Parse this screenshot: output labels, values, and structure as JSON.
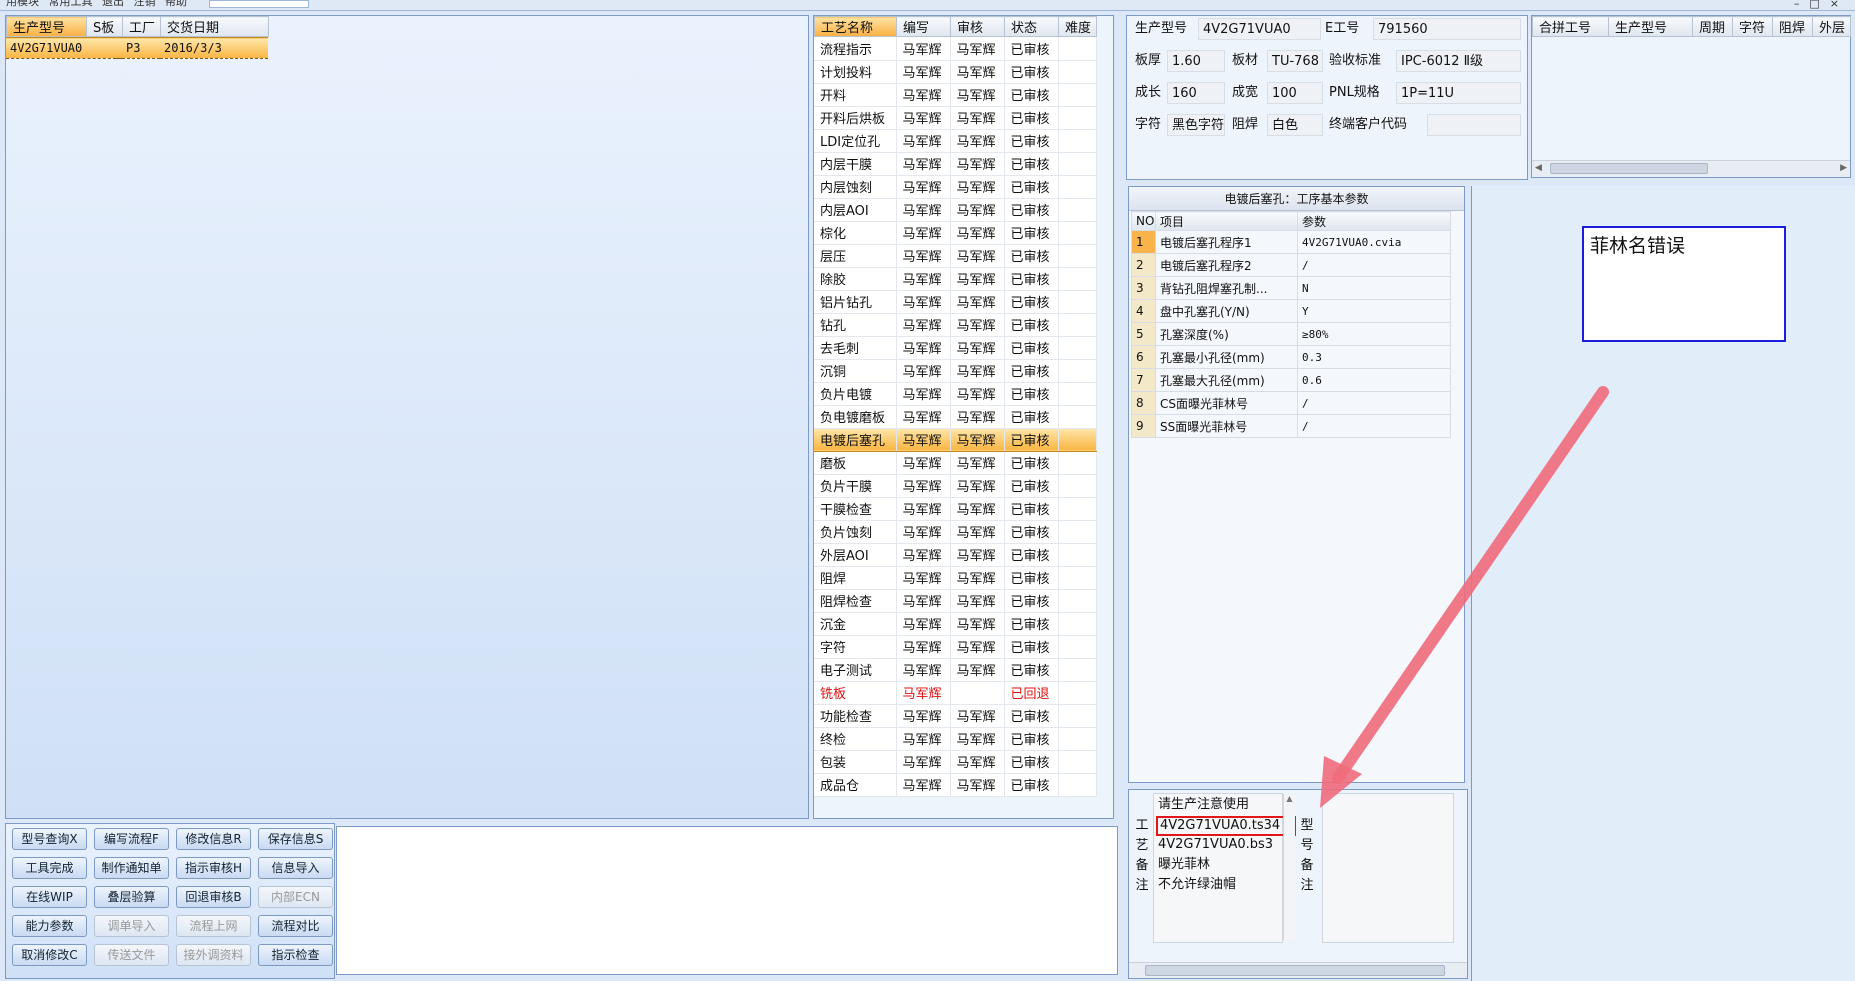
{
  "menubar": {
    "items": [
      "用模块",
      "常用工具",
      "退出",
      "注销",
      "帮助"
    ]
  },
  "window_controls": [
    "–",
    "□",
    "×"
  ],
  "orders": {
    "headers": [
      "生产型号",
      "S板",
      "工厂",
      "交货日期"
    ],
    "rows": [
      {
        "model": "4V2G71VUA0",
        "s": "",
        "factory": "P3",
        "date": "2016/3/3"
      }
    ]
  },
  "process": {
    "headers": [
      "工艺名称",
      "编写",
      "审核",
      "状态",
      "难度"
    ],
    "rows": [
      {
        "name": "流程指示",
        "writer": "马军辉",
        "reviewer": "马军辉",
        "status": "已审核"
      },
      {
        "name": "计划投料",
        "writer": "马军辉",
        "reviewer": "马军辉",
        "status": "已审核"
      },
      {
        "name": "开料",
        "writer": "马军辉",
        "reviewer": "马军辉",
        "status": "已审核"
      },
      {
        "name": "开料后烘板",
        "writer": "马军辉",
        "reviewer": "马军辉",
        "status": "已审核"
      },
      {
        "name": "LDI定位孔",
        "writer": "马军辉",
        "reviewer": "马军辉",
        "status": "已审核"
      },
      {
        "name": "内层干膜",
        "writer": "马军辉",
        "reviewer": "马军辉",
        "status": "已审核"
      },
      {
        "name": "内层蚀刻",
        "writer": "马军辉",
        "reviewer": "马军辉",
        "status": "已审核"
      },
      {
        "name": "内层AOI",
        "writer": "马军辉",
        "reviewer": "马军辉",
        "status": "已审核"
      },
      {
        "name": "棕化",
        "writer": "马军辉",
        "reviewer": "马军辉",
        "status": "已审核"
      },
      {
        "name": "层压",
        "writer": "马军辉",
        "reviewer": "马军辉",
        "status": "已审核"
      },
      {
        "name": "除胶",
        "writer": "马军辉",
        "reviewer": "马军辉",
        "status": "已审核"
      },
      {
        "name": "铝片钻孔",
        "writer": "马军辉",
        "reviewer": "马军辉",
        "status": "已审核"
      },
      {
        "name": "钻孔",
        "writer": "马军辉",
        "reviewer": "马军辉",
        "status": "已审核"
      },
      {
        "name": "去毛刺",
        "writer": "马军辉",
        "reviewer": "马军辉",
        "status": "已审核"
      },
      {
        "name": "沉铜",
        "writer": "马军辉",
        "reviewer": "马军辉",
        "status": "已审核"
      },
      {
        "name": "负片电镀",
        "writer": "马军辉",
        "reviewer": "马军辉",
        "status": "已审核"
      },
      {
        "name": "负电镀磨板",
        "writer": "马军辉",
        "reviewer": "马军辉",
        "status": "已审核"
      },
      {
        "name": "电镀后塞孔",
        "writer": "马军辉",
        "reviewer": "马军辉",
        "status": "已审核"
      },
      {
        "name": "磨板",
        "writer": "马军辉",
        "reviewer": "马军辉",
        "status": "已审核"
      },
      {
        "name": "负片干膜",
        "writer": "马军辉",
        "reviewer": "马军辉",
        "status": "已审核"
      },
      {
        "name": "干膜检查",
        "writer": "马军辉",
        "reviewer": "马军辉",
        "status": "已审核"
      },
      {
        "name": "负片蚀刻",
        "writer": "马军辉",
        "reviewer": "马军辉",
        "status": "已审核"
      },
      {
        "name": "外层AOI",
        "writer": "马军辉",
        "reviewer": "马军辉",
        "status": "已审核"
      },
      {
        "name": "阻焊",
        "writer": "马军辉",
        "reviewer": "马军辉",
        "status": "已审核"
      },
      {
        "name": "阻焊检查",
        "writer": "马军辉",
        "reviewer": "马军辉",
        "status": "已审核"
      },
      {
        "name": "沉金",
        "writer": "马军辉",
        "reviewer": "马军辉",
        "status": "已审核"
      },
      {
        "name": "字符",
        "writer": "马军辉",
        "reviewer": "马军辉",
        "status": "已审核"
      },
      {
        "name": "电子测试",
        "writer": "马军辉",
        "reviewer": "马军辉",
        "status": "已审核"
      },
      {
        "name": "铣板",
        "writer": "马军辉",
        "reviewer": "",
        "status": "已回退"
      },
      {
        "name": "功能检查",
        "writer": "马军辉",
        "reviewer": "马军辉",
        "status": "已审核"
      },
      {
        "name": "终检",
        "writer": "马军辉",
        "reviewer": "马军辉",
        "status": "已审核"
      },
      {
        "name": "包装",
        "writer": "马军辉",
        "reviewer": "马军辉",
        "status": "已审核"
      },
      {
        "name": "成品仓",
        "writer": "马军辉",
        "reviewer": "马军辉",
        "status": "已审核"
      }
    ]
  },
  "info": {
    "model_label": "生产型号",
    "model": "4V2G71VUA0",
    "ejob_label": "E工号",
    "ejob": "791560",
    "thick_label": "板厚",
    "thick": "1.60",
    "material_label": "板材",
    "material": "TU-768",
    "std_label": "验收标准",
    "std": "IPC-6012 Ⅱ级",
    "len_label": "成长",
    "len": "160",
    "wid_label": "成宽",
    "wid": "100",
    "pnl_label": "PNL规格",
    "pnl": "1P=11U",
    "char_label": "字符",
    "char": "黑色字符",
    "mask_label": "阻焊",
    "mask": "白色",
    "cust_label": "终端客户代码",
    "cust": ""
  },
  "combine": {
    "headers": [
      "合拼工号",
      "生产型号",
      "周期",
      "字符",
      "阻焊",
      "外层"
    ]
  },
  "steps": {
    "title": "电镀后塞孔：工序基本参数",
    "headers": [
      "NO",
      "项目",
      "参数"
    ],
    "rows": [
      {
        "no": "1",
        "item": "电镀后塞孔程序1",
        "value": "4V2G71VUA0.cvia"
      },
      {
        "no": "2",
        "item": "电镀后塞孔程序2",
        "value": "/"
      },
      {
        "no": "3",
        "item": "背钻孔阻焊塞孔制...",
        "value": "N"
      },
      {
        "no": "4",
        "item": "盘中孔塞孔(Y/N)",
        "value": "Y"
      },
      {
        "no": "5",
        "item": "孔塞深度(%)",
        "value": "≥80%"
      },
      {
        "no": "6",
        "item": "孔塞最小孔径(mm)",
        "value": "0.3"
      },
      {
        "no": "7",
        "item": "孔塞最大孔径(mm)",
        "value": "0.6"
      },
      {
        "no": "8",
        "item": "CS面曝光菲林号",
        "value": "/"
      },
      {
        "no": "9",
        "item": "SS面曝光菲林号",
        "value": "/"
      }
    ]
  },
  "annotation": {
    "text": "菲林名错误",
    "box_color": "#1d1de0",
    "arrow_color": "#f06c7c",
    "highlight_color": "#e01818"
  },
  "notes": {
    "craft_label": [
      "工",
      "艺",
      "备",
      "注"
    ],
    "type_label": [
      "型",
      "号",
      "备",
      "注"
    ],
    "lines": [
      "请生产注意使用",
      "4V2G71VUA0.ts34",
      "4V2G71VUA0.bs3",
      "曝光菲林",
      "不允许绿油帽"
    ]
  },
  "buttons": [
    {
      "label": "型号查询X",
      "enabled": true
    },
    {
      "label": "编写流程F",
      "enabled": true
    },
    {
      "label": "修改信息R",
      "enabled": true
    },
    {
      "label": "保存信息S",
      "enabled": true
    },
    {
      "label": "工具完成",
      "enabled": true
    },
    {
      "label": "制作通知单",
      "enabled": true
    },
    {
      "label": "指示审核H",
      "enabled": true
    },
    {
      "label": "信息导入",
      "enabled": true
    },
    {
      "label": "在线WIP",
      "enabled": true
    },
    {
      "label": "叠层验算",
      "enabled": true
    },
    {
      "label": "回退审核B",
      "enabled": true
    },
    {
      "label": "内部ECN",
      "enabled": false
    },
    {
      "label": "能力参数",
      "enabled": true
    },
    {
      "label": "调单导入",
      "enabled": false
    },
    {
      "label": "流程上网",
      "enabled": false
    },
    {
      "label": "流程对比",
      "enabled": true
    },
    {
      "label": "取消修改C",
      "enabled": true
    },
    {
      "label": "传送文件",
      "enabled": false
    },
    {
      "label": "接外调资料",
      "enabled": false
    },
    {
      "label": "指示检查",
      "enabled": true
    }
  ]
}
